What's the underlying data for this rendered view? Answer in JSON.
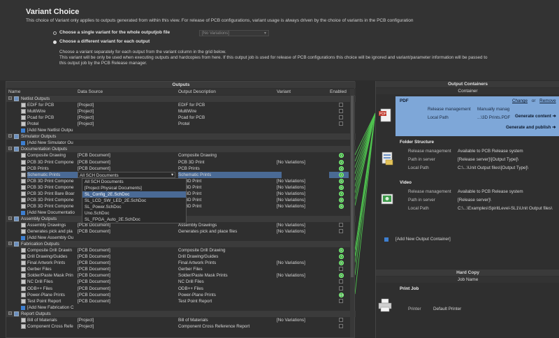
{
  "header": {
    "title": "Variant Choice",
    "description": "This choice of Variant only applies to outputs generated from within this view. For release of PCB configurations, variant usage is always driven by the choice of variants in the PCB configuration",
    "option_single": "Choose a single variant for the whole outputjob file",
    "option_single_value": "[No Variations]",
    "option_each": "Choose a different variant for each output",
    "para1": "Choose a variant separately for each output from the variant column in the grid below.",
    "para2": "This variant will be only be used when executing outputs and hardcopies from here. If this output job is used for release of PCB configurations this choice will be ignored and variant/parameter information will be passed to",
    "para3": "this output job by the PCB Release manager."
  },
  "outputs": {
    "title": "Outputs",
    "columns": [
      "Name",
      "Data Source",
      "Output Description",
      "Variant",
      "Enabled"
    ],
    "rows": [
      {
        "type": "group",
        "name": "Netlist Outputs"
      },
      {
        "type": "item",
        "name": "EDIF for PCB",
        "source": "[Project]",
        "desc": "EDIF for PCB",
        "variant": "",
        "enabled": false
      },
      {
        "type": "item",
        "name": "MultiWire",
        "source": "[Project]",
        "desc": "MultiWire",
        "variant": "",
        "enabled": false
      },
      {
        "type": "item",
        "name": "Pcad for PCB",
        "source": "[Project]",
        "desc": "Pcad for PCB",
        "variant": "",
        "enabled": false
      },
      {
        "type": "item",
        "name": "Protel",
        "source": "[Project]",
        "desc": "Protel",
        "variant": "",
        "enabled": false
      },
      {
        "type": "add",
        "name": "[Add New Netlist Outpu"
      },
      {
        "type": "group",
        "name": "Simulator Outputs"
      },
      {
        "type": "add",
        "name": "[Add New Simulator Ou"
      },
      {
        "type": "group",
        "name": "Documentation Outputs"
      },
      {
        "type": "item",
        "name": "Composite Drawing",
        "source": "[PCB Document]",
        "desc": "Composite Drawing",
        "variant": "",
        "enabled": true,
        "num": "1"
      },
      {
        "type": "item",
        "name": "PCB 3D Print Compone",
        "source": "[PCB Document]",
        "desc": "PCB 3D Print",
        "variant": "[No Variations]",
        "enabled": true,
        "num": "2"
      },
      {
        "type": "item",
        "name": "PCB Prints",
        "source": "[PCB Document]",
        "desc": "PCB Prints",
        "variant": "",
        "enabled": true,
        "num": "3"
      },
      {
        "type": "sel",
        "name": "Schematic Prints",
        "source": "All SCH Documents",
        "desc": "Schematic Prints",
        "variant": "",
        "enabled": true,
        "num": "4"
      },
      {
        "type": "item",
        "name": "PCB 3D Print Compone",
        "source": "",
        "desc": "CB 3D Print",
        "variant": "[No Variations]",
        "enabled": true,
        "num": "5"
      },
      {
        "type": "item",
        "name": "PCB 3D Print Compone",
        "source": "",
        "desc": "CB 3D Print",
        "variant": "[No Variations]",
        "enabled": true,
        "num": "6"
      },
      {
        "type": "item",
        "name": "PCB 3D Print Bare Boar",
        "source": "",
        "desc": "CB 3D Print",
        "variant": "[No Variations]",
        "enabled": true,
        "num": "7"
      },
      {
        "type": "item",
        "name": "PCB 3D Print Compone",
        "source": "",
        "desc": "CB 3D Print",
        "variant": "[No Variations]",
        "enabled": true,
        "num": "8"
      },
      {
        "type": "item",
        "name": "PCB 3D Print Compone",
        "source": "",
        "desc": "CB 3D Print",
        "variant": "[No Variations]",
        "enabled": true,
        "num": "9"
      },
      {
        "type": "add",
        "name": "[Add New Documentatio"
      },
      {
        "type": "group",
        "name": "Assembly Outputs"
      },
      {
        "type": "item",
        "name": "Assembly Drawings",
        "source": "[PCB Document]",
        "desc": "Assembly Drawings",
        "variant": "[No Variations]",
        "enabled": false
      },
      {
        "type": "item",
        "name": "Generates pick and pla",
        "source": "[PCB Document]",
        "desc": "Generates pick and place files",
        "variant": "[No Variations]",
        "enabled": false
      },
      {
        "type": "add",
        "name": "[Add New Assembly Ou"
      },
      {
        "type": "group",
        "name": "Fabrication Outputs"
      },
      {
        "type": "item",
        "name": "Composite Drill Drawin",
        "source": "[PCB Document]",
        "desc": "Composite Drill Drawing",
        "variant": "",
        "enabled": true,
        "num": "6"
      },
      {
        "type": "item",
        "name": "Drill Drawing/Guides",
        "source": "[PCB Document]",
        "desc": "Drill Drawing/Guides",
        "variant": "",
        "enabled": true,
        "num": "7"
      },
      {
        "type": "item",
        "name": "Final Artwork Prints",
        "source": "[PCB Document]",
        "desc": "Final Artwork Prints",
        "variant": "[No Variations]",
        "enabled": true,
        "num": "8"
      },
      {
        "type": "item",
        "name": "Gerber Files",
        "source": "[PCB Document]",
        "desc": "Gerber Files",
        "variant": "",
        "enabled": false
      },
      {
        "type": "item",
        "name": "Solder/Paste Mask Prin",
        "source": "[PCB Document]",
        "desc": "Solder/Paste Mask Prints",
        "variant": "[No Variations]",
        "enabled": true,
        "num": "9"
      },
      {
        "type": "item",
        "name": "NC Drill Files",
        "source": "[PCB Document]",
        "desc": "NC Drill Files",
        "variant": "",
        "enabled": false
      },
      {
        "type": "item",
        "name": "ODB++ Files",
        "source": "[PCB Document]",
        "desc": "ODB++ Files",
        "variant": "",
        "enabled": false
      },
      {
        "type": "item",
        "name": "Power-Plane Prints",
        "source": "[PCB Document]",
        "desc": "Power-Plane Prints",
        "variant": "",
        "enabled": true,
        "num": "10"
      },
      {
        "type": "item",
        "name": "Test Point Report",
        "source": "[PCB Document]",
        "desc": "Test Point Report",
        "variant": "",
        "enabled": false
      },
      {
        "type": "add",
        "name": "[Add New Fabrication C"
      },
      {
        "type": "group",
        "name": "Report Outputs"
      },
      {
        "type": "item",
        "name": "Bill of Materials",
        "source": "[Project]",
        "desc": "Bill of Materials",
        "variant": "[No Variations]",
        "enabled": false
      },
      {
        "type": "item",
        "name": "Component Cross Refe",
        "source": "[Project]",
        "desc": "Component Cross Reference Report",
        "variant": "",
        "enabled": false
      }
    ],
    "dropdown": [
      "All SCH Documents",
      "[Project Physical Documents]",
      "SL_Config_2E.SchDoc",
      "SL_LCD_SW_LED_2E.SchDoc",
      "SL_Power.SchDoc",
      "Uno.SchDoc",
      "SL_FPGA_Auto_2E.SchDoc"
    ]
  },
  "containers": {
    "title": "Output Containers",
    "subtitle": "Container",
    "pdf": {
      "name": "PDF",
      "change": "Change",
      "or": "or",
      "remove": "Remove",
      "release_label": "Release management",
      "release_value": "Manually manag",
      "local_label": "Local Path",
      "local_value": "...\\3D Prints.PDF",
      "generate": "Generate content",
      "publish": "Generate and publish"
    },
    "folder": {
      "name": "Folder Structure",
      "release_label": "Release management",
      "release_value": "Available to PCB Release system",
      "server_label": "Path in server",
      "server_value": "[Release server]\\[Output Type]\\",
      "local_label": "Local Path",
      "local_value": "C:\\...\\Unit Output files\\[Output Type]\\"
    },
    "video": {
      "name": "Video",
      "release_label": "Release management",
      "release_value": "Available to PCB Release system",
      "server_label": "Path in server",
      "server_value": "[Release server]\\",
      "local_label": "Local Path",
      "local_value": "C:\\...\\Examples\\SpiritLevel-SL1\\Unit Output files\\"
    },
    "add_new": "[Add New Output Container]"
  },
  "hardcopy": {
    "title": "Hard Copy",
    "subtitle": "Job Name",
    "job": "Print Job",
    "printer_label": "Printer",
    "printer_value": "Default Printer"
  }
}
